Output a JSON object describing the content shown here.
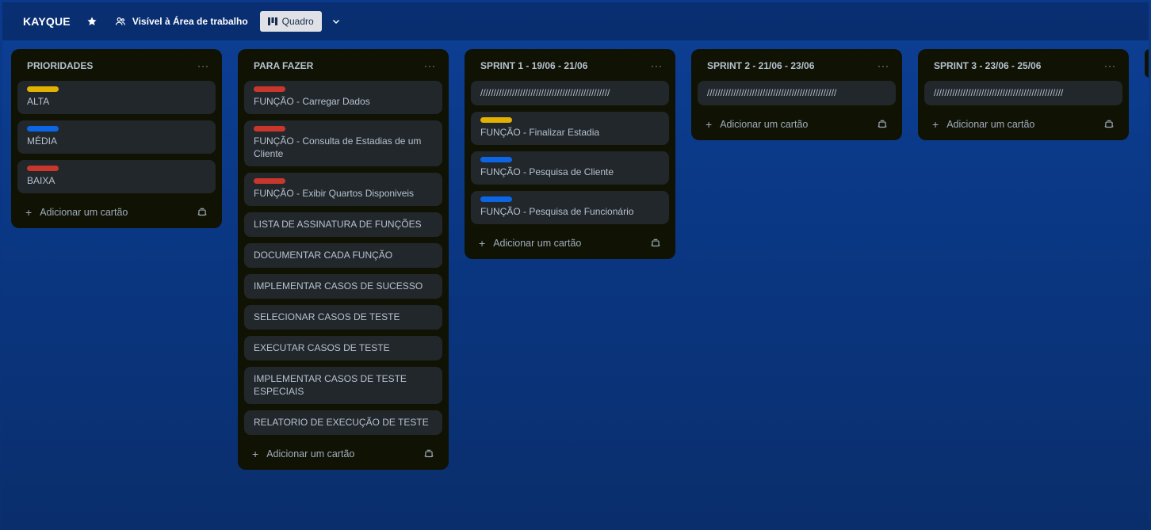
{
  "header": {
    "board_title": "KAYQUE",
    "visibility": "Visível à Área de trabalho",
    "view_button": "Quadro"
  },
  "colors": {
    "yellow": "#e2b203",
    "blue": "#0c66e4",
    "red": "#c9372c"
  },
  "add_card_label": "Adicionar um cartão",
  "lists": [
    {
      "title": "PRIORIDADES",
      "cards": [
        {
          "label": "yellow",
          "title": "ALTA"
        },
        {
          "label": "blue",
          "title": "MÉDIA"
        },
        {
          "label": "red",
          "title": "BAIXA"
        }
      ]
    },
    {
      "title": "PARA FAZER",
      "cards": [
        {
          "label": "red",
          "title": "FUNÇÃO - Carregar Dados"
        },
        {
          "label": "red",
          "title": "FUNÇÃO - Consulta de Estadias de um Cliente"
        },
        {
          "label": "red",
          "title": "FUNÇÃO - Exibir Quartos Disponiveis"
        },
        {
          "label": null,
          "title": "LISTA DE ASSINATURA DE FUNÇÕES"
        },
        {
          "label": null,
          "title": "DOCUMENTAR CADA FUNÇÃO"
        },
        {
          "label": null,
          "title": "IMPLEMENTAR CASOS DE SUCESSO"
        },
        {
          "label": null,
          "title": "SELECIONAR CASOS DE TESTE"
        },
        {
          "label": null,
          "title": "EXECUTAR CASOS DE TESTE"
        },
        {
          "label": null,
          "title": "IMPLEMENTAR CASOS DE TESTE ESPECIAIS"
        },
        {
          "label": null,
          "title": "RELATORIO DE EXECUÇÃO DE TESTE"
        }
      ]
    },
    {
      "title": "SPRINT 1 - 19/06 - 21/06",
      "cards": [
        {
          "label": null,
          "title": "/////////////////////////////////////////////////"
        },
        {
          "label": "yellow",
          "title": "FUNÇÃO - Finalizar Estadia"
        },
        {
          "label": "blue",
          "title": "FUNÇÃO - Pesquisa de Cliente"
        },
        {
          "label": "blue",
          "title": "FUNÇÃO - Pesquisa de Funcionário"
        }
      ]
    },
    {
      "title": "SPRINT 2 - 21/06 - 23/06",
      "cards": [
        {
          "label": null,
          "title": "/////////////////////////////////////////////////"
        }
      ]
    },
    {
      "title": "SPRINT 3 - 23/06 - 25/06",
      "cards": [
        {
          "label": null,
          "title": "/////////////////////////////////////////////////"
        }
      ]
    }
  ]
}
